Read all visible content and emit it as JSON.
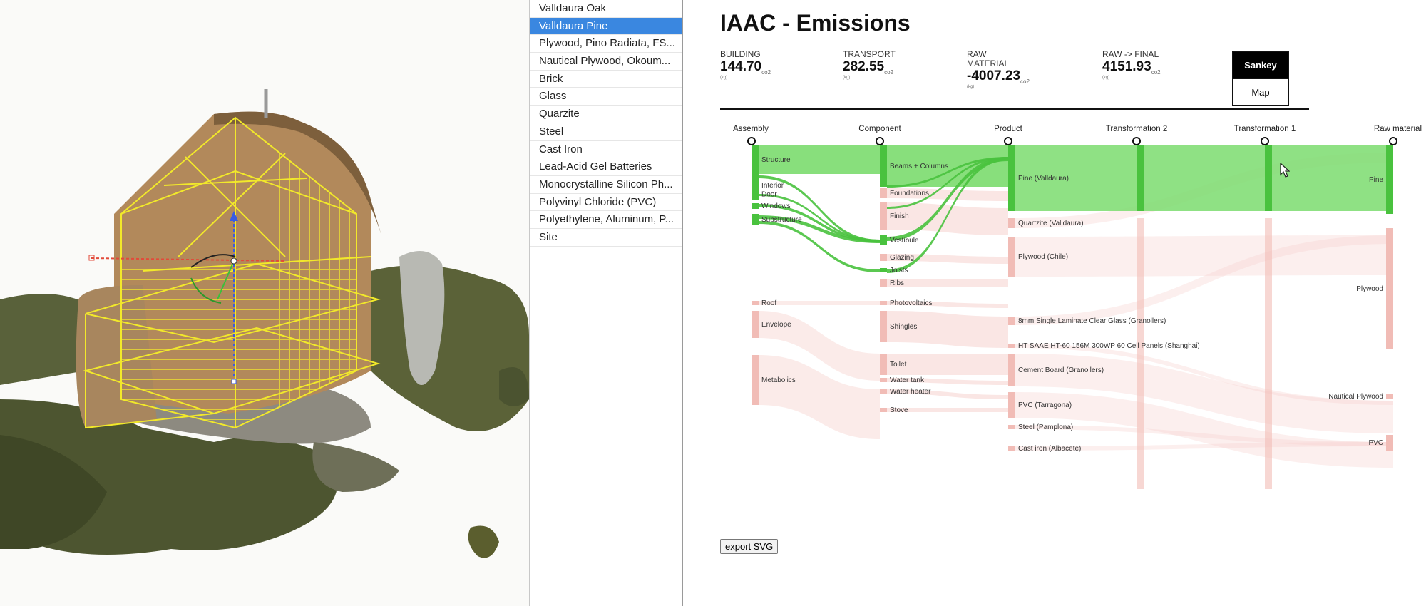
{
  "materials": {
    "items": [
      {
        "label": "Valldaura Oak"
      },
      {
        "label": "Valldaura Pine",
        "selected": true
      },
      {
        "label": "Plywood, Pino Radiata, FS..."
      },
      {
        "label": "Nautical Plywood, Okoum..."
      },
      {
        "label": "Brick"
      },
      {
        "label": "Glass"
      },
      {
        "label": "Quarzite"
      },
      {
        "label": "Steel"
      },
      {
        "label": "Cast Iron"
      },
      {
        "label": "Lead-Acid Gel Batteries"
      },
      {
        "label": "Monocrystalline Silicon Ph..."
      },
      {
        "label": "Polyvinyl Chloride (PVC)"
      },
      {
        "label": "Polyethylene, Aluminum, P..."
      },
      {
        "label": "Site"
      }
    ]
  },
  "dashboard": {
    "title": "IAAC - Emissions",
    "stats": [
      {
        "label": "BUILDING",
        "value": "144.70",
        "sub": "co2",
        "unit": "(kg)"
      },
      {
        "label": "TRANSPORT",
        "value": "282.55",
        "sub": "co2",
        "unit": "(kg)"
      },
      {
        "label": "RAW MATERIAL",
        "value": "-4007.23",
        "sub": "co2",
        "unit": "(kg)"
      },
      {
        "label": "RAW -> FINAL",
        "value": "4151.93",
        "sub": "co2",
        "unit": "(kg)"
      }
    ],
    "view_buttons": {
      "sankey": "Sankey",
      "map": "Map"
    },
    "export_label": "export SVG"
  },
  "sankey": {
    "columns": [
      "Assembly",
      "Component",
      "Product",
      "Transformation 2",
      "Transformation 1",
      "Raw material"
    ],
    "assembly": [
      "Structure",
      "Interior",
      "Door",
      "Windows",
      "Substructure",
      "Roof",
      "Envelope",
      "Metabolics"
    ],
    "component": [
      "Beams + Columns",
      "Foundations",
      "Finish",
      "Vestibule",
      "Glazing",
      "Joists",
      "Ribs",
      "Photovoltaics",
      "Shingles",
      "Toilet",
      "Water tank",
      "Water heater",
      "Stove"
    ],
    "product": [
      "Pine (Valldaura)",
      "Quartzite (Valldaura)",
      "Plywood (Chile)",
      "8mm Single Laminate Clear Glass (Granollers)",
      "HT SAAE HT-60 156M 300WP 60 Cell Panels (Shanghai)",
      "Cement Board (Granollers)",
      "PVC (Tarragona)",
      "Steel (Pamplona)",
      "Cast iron (Albacete)"
    ],
    "raw": [
      "Pine",
      "Plywood",
      "Nautical Plywood",
      "PVC"
    ],
    "colors": {
      "highlight": "#7bdc6e",
      "highlight_dark": "#49c23e",
      "muted": "#f6d2ce",
      "muted_dark": "#f1bcb6"
    }
  }
}
